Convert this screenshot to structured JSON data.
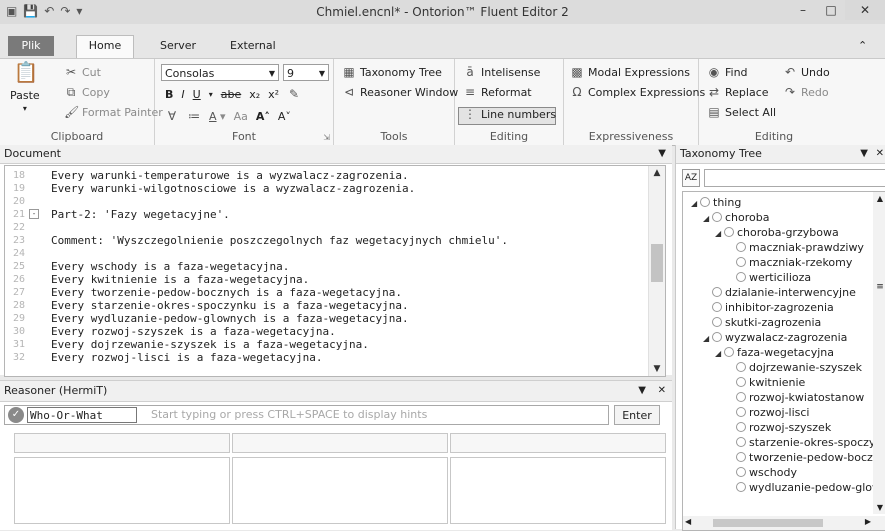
{
  "window": {
    "title": "Chmiel.encnl* - Ontorion™ Fluent Editor 2",
    "controls": [
      "–",
      "□",
      "✕"
    ]
  },
  "tabs": [
    "Plik",
    "Home",
    "Server",
    "External"
  ],
  "ribbon": {
    "clipboard": {
      "paste": "Paste",
      "cut": "Cut",
      "copy": "Copy",
      "format_painter": "Format Painter",
      "label": "Clipboard"
    },
    "font": {
      "family": "Consolas",
      "size": "9",
      "label": "Font",
      "bold": "B",
      "italic": "I",
      "underline": "U",
      "strike": "abe",
      "sub": "x₂",
      "sup": "x²",
      "grow": "A˄",
      "shrink": "A˅",
      "case": "Aa"
    },
    "tools": {
      "taxonomy_tree": "Taxonomy Tree",
      "reasoner_window": "Reasoner Window",
      "label": "Tools"
    },
    "editing": {
      "intelisense": "Intelisense",
      "reformat": "Reformat",
      "line_numbers": "Line numbers",
      "label": "Editing"
    },
    "expressiveness": {
      "modal": "Modal Expressions",
      "complex": "Complex Expressions",
      "label": "Expressiveness"
    },
    "editing2": {
      "find": "Find",
      "undo": "Undo",
      "replace": "Replace",
      "redo": "Redo",
      "select_all": "Select All",
      "label": "Editing"
    }
  },
  "document": {
    "title": "Document",
    "lines": [
      {
        "no": "18",
        "text": "Every warunki-temperaturowe is a wyzwalacz-zagrozenia."
      },
      {
        "no": "19",
        "text": "Every warunki-wilgotnosciowe is a wyzwalacz-zagrozenia."
      },
      {
        "no": "20",
        "text": ""
      },
      {
        "no": "21",
        "text": "Part-2: 'Fazy wegetacyjne'."
      },
      {
        "no": "22",
        "text": ""
      },
      {
        "no": "23",
        "text": "Comment: 'Wyszczegolnienie poszczegolnych faz wegetacyjnych chmielu'."
      },
      {
        "no": "24",
        "text": ""
      },
      {
        "no": "25",
        "text": "Every wschody is a faza-wegetacyjna."
      },
      {
        "no": "26",
        "text": "Every kwitnienie is a faza-wegetacyjna."
      },
      {
        "no": "27",
        "text": "Every tworzenie-pedow-bocznych is a faza-wegetacyjna."
      },
      {
        "no": "28",
        "text": "Every starzenie-okres-spoczynku is a faza-wegetacyjna."
      },
      {
        "no": "29",
        "text": "Every wydluzanie-pedow-glownych is a faza-wegetacyjna."
      },
      {
        "no": "30",
        "text": "Every rozwoj-szyszek is a faza-wegetacyjna."
      },
      {
        "no": "31",
        "text": "Every dojrzewanie-szyszek is a faza-wegetacyjna."
      },
      {
        "no": "32",
        "text": "Every rozwoj-lisci is a faza-wegetacyjna."
      }
    ]
  },
  "reasoner": {
    "title": "Reasoner (HermiT)",
    "query_type": "Who-Or-What",
    "placeholder": "Start typing or press CTRL+SPACE to display hints",
    "enter": "Enter"
  },
  "taxonomy": {
    "title": "Taxonomy Tree",
    "nodes": [
      {
        "label": "thing"
      },
      {
        "label": "choroba"
      },
      {
        "label": "choroba-grzybowa"
      },
      {
        "label": "maczniak-prawdziwy"
      },
      {
        "label": "maczniak-rzekomy"
      },
      {
        "label": "werticilioza"
      },
      {
        "label": "dzialanie-interwencyjne"
      },
      {
        "label": "inhibitor-zagrozenia"
      },
      {
        "label": "skutki-zagrozenia"
      },
      {
        "label": "wyzwalacz-zagrozenia"
      },
      {
        "label": "faza-wegetacyjna"
      },
      {
        "label": "dojrzewanie-szyszek"
      },
      {
        "label": "kwitnienie"
      },
      {
        "label": "rozwoj-kwiatostanow"
      },
      {
        "label": "rozwoj-lisci"
      },
      {
        "label": "rozwoj-szyszek"
      },
      {
        "label": "starzenie-okres-spoczynku"
      },
      {
        "label": "tworzenie-pedow-bocznych"
      },
      {
        "label": "wschody"
      },
      {
        "label": "wydluzanie-pedow-glownych"
      }
    ]
  }
}
